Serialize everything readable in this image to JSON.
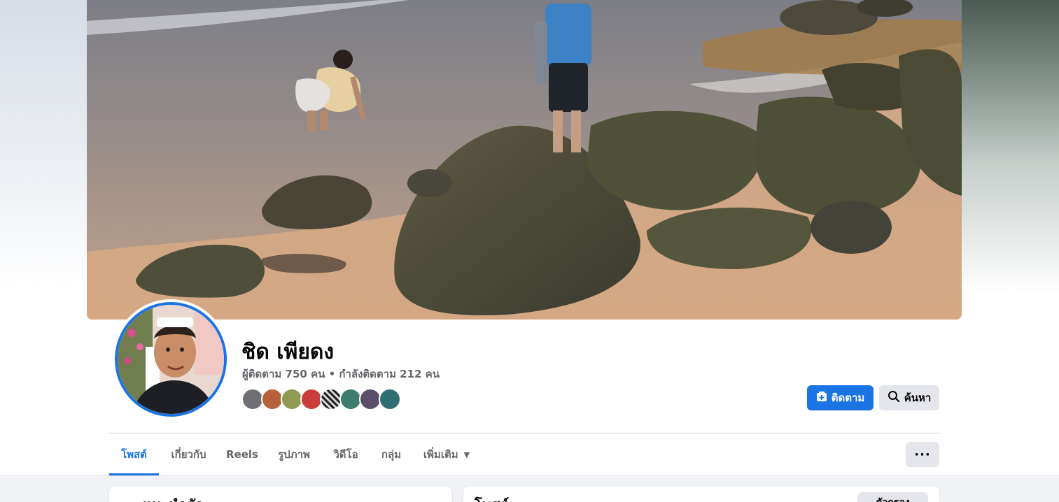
{
  "profile": {
    "name": "ชิด เพียดง",
    "followers_line": "ผู้ติดตาม 750 คน • กำลังติดตาม 212 คน"
  },
  "actions": {
    "follow_label": "ติดตาม",
    "search_label": "ค้นหา"
  },
  "tabs": [
    {
      "label": "โพสต์",
      "active": true
    },
    {
      "label": "เกี่ยวกับ",
      "active": false
    },
    {
      "label": "Reels",
      "active": false
    },
    {
      "label": "รูปภาพ",
      "active": false
    },
    {
      "label": "วิดีโอ",
      "active": false
    },
    {
      "label": "กลุ่ม",
      "active": false
    },
    {
      "label": "เพิ่มเติม",
      "active": false
    }
  ],
  "more_menu_label": "···",
  "feed": {
    "left_card_title": "แนะนำตัว",
    "right_card_title": "โพสต์",
    "filter_label": "ตัวกรอง"
  },
  "colors": {
    "accent": "#1b74e4",
    "secondary_button": "#e4e6eb",
    "muted_text": "#65676b",
    "feed_background": "#f0f2f5"
  },
  "icons": {
    "follow": "follow-icon",
    "search": "search-icon",
    "dropdown": "caret-down-icon",
    "more": "more-dots-icon"
  }
}
